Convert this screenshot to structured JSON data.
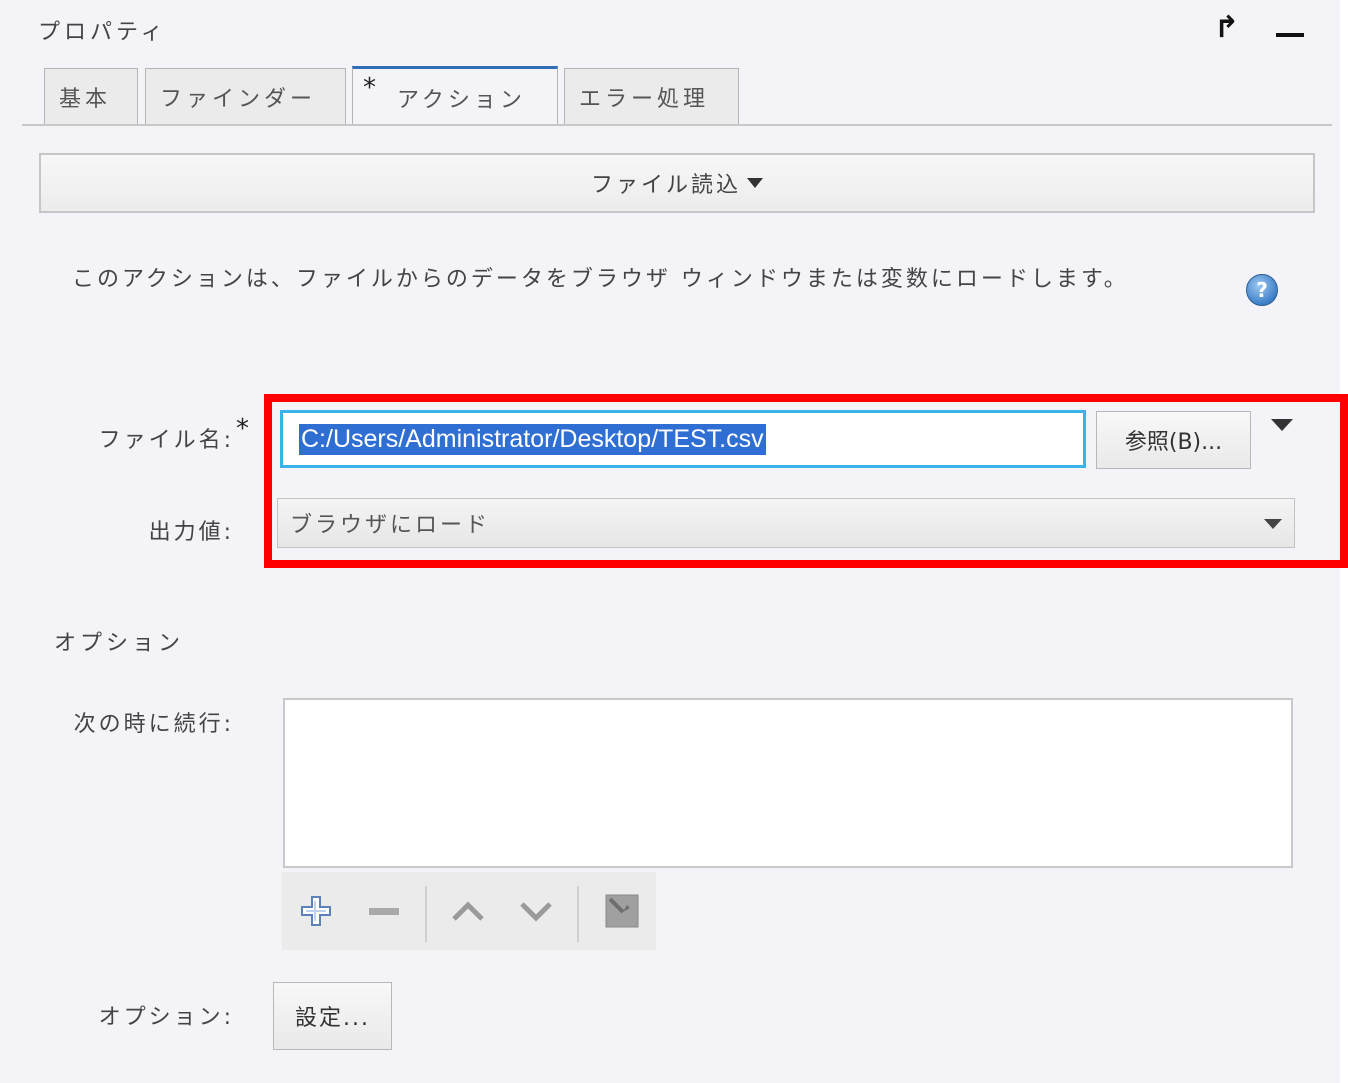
{
  "panel": {
    "title": "プロパティ",
    "pop_out_glyph": "↱",
    "icons": {
      "pop_out": "pop-out-arrow-icon",
      "minimize": "minimize-icon"
    }
  },
  "tabs": [
    {
      "label": "基本",
      "active": false,
      "modified": false
    },
    {
      "label": "ファインダー",
      "active": false,
      "modified": false
    },
    {
      "label": "アクション",
      "active": true,
      "modified": true,
      "modified_marker": "*"
    },
    {
      "label": "エラー処理",
      "active": false,
      "modified": false
    }
  ],
  "action_selector": {
    "label": "ファイル読込"
  },
  "description": {
    "text": "このアクションは、ファイルからのデータをブラウザ ウィンドウまたは変数にロードします。",
    "help_icon": "help-icon",
    "help_glyph": "?"
  },
  "form": {
    "filename": {
      "label": "ファイル名:",
      "required_marker": "*",
      "value": "C:/Users/Administrator/Desktop/TEST.csv",
      "browse_label": "参照(B)..."
    },
    "output": {
      "label": "出力値:",
      "selected": "ブラウザにロード"
    }
  },
  "options": {
    "heading": "オプション",
    "continue_on": {
      "label": "次の時に続行:",
      "items": []
    },
    "toolbar_icons": [
      "add-icon",
      "remove-icon",
      "move-up-icon",
      "move-down-icon",
      "edit-icon"
    ],
    "settings": {
      "label": "オプション:",
      "button_label": "設定..."
    }
  },
  "colors": {
    "highlight": "#ff0000",
    "active_tab_accent": "#2f6db5",
    "input_focus": "#3ab4e8",
    "selection": "#2f6fd4",
    "panel_background": "#f3f3f8"
  }
}
